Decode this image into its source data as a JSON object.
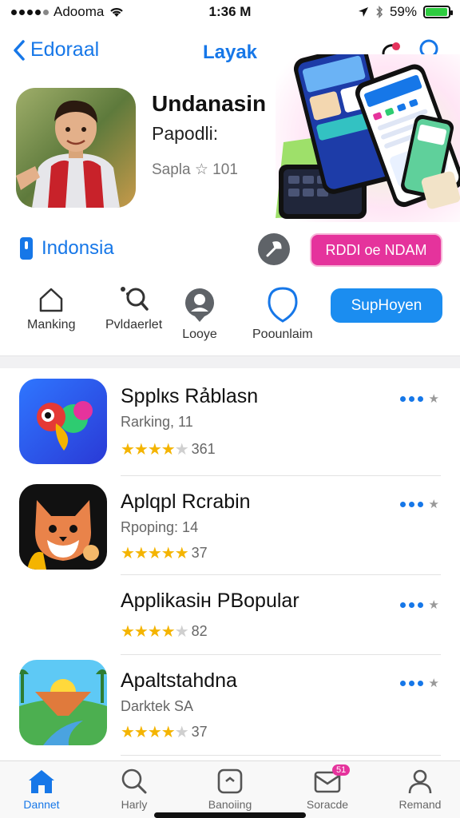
{
  "status": {
    "carrier": "Adooma",
    "time": "1:36 M",
    "battery": "59%",
    "battery_level": 0.95
  },
  "nav": {
    "back_label": "Edoraal",
    "title": "Layak"
  },
  "hero": {
    "title": "Undanasin",
    "subtitle": "Papodli:",
    "rating": "Saplа ☆ 101"
  },
  "region": {
    "label": "Indonsia"
  },
  "buttons": {
    "pink": "RDDI oe NDAM",
    "blue": "SupHoyen"
  },
  "categories": [
    {
      "label": "Manking",
      "icon": "house-icon"
    },
    {
      "label": "Pvldaerlet",
      "icon": "magnify-icon"
    },
    {
      "label": "Looye",
      "icon": "pin-icon"
    },
    {
      "label": "Poounlaim",
      "icon": "chat-icon"
    }
  ],
  "apps": [
    {
      "name": "Spplкs Rảblasn",
      "meta": "Rarking, 11",
      "rating": 3.5,
      "count": "361",
      "icon": "parrot-app-icon"
    },
    {
      "name": "Aplqpl Rcrabin",
      "meta": "Rpoping: 14",
      "rating": 4.5,
      "count": "37",
      "icon": "fox-app-icon"
    },
    {
      "name": "Applikasiн PBopular",
      "meta": "",
      "rating": 4,
      "count": "82",
      "icon": ""
    },
    {
      "name": "Apaltstahdna",
      "meta": "Darktek SA",
      "rating": 4,
      "count": "37",
      "icon": "landscape-app-icon"
    }
  ],
  "tabs": [
    {
      "label": "Dannet",
      "icon": "home-icon",
      "active": true
    },
    {
      "label": "Harly",
      "icon": "search-icon",
      "active": false
    },
    {
      "label": "Banoiing",
      "icon": "screen-icon",
      "active": false
    },
    {
      "label": "Soracde",
      "icon": "inbox-icon",
      "active": false,
      "badge": "51"
    },
    {
      "label": "Remand",
      "icon": "person-icon",
      "active": false
    }
  ],
  "colors": {
    "accent": "#1677e8",
    "pink": "#e5339c",
    "star": "#f4b400"
  }
}
